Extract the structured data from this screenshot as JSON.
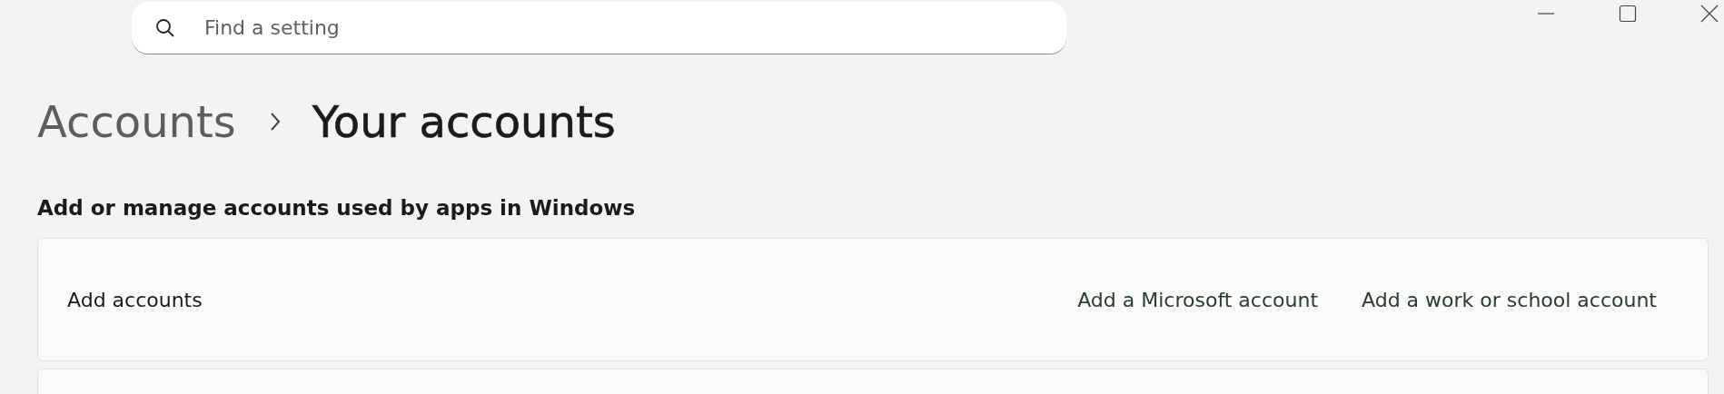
{
  "search": {
    "placeholder": "Find a setting"
  },
  "window_controls": [
    {
      "kind": "minimize"
    },
    {
      "kind": "maximize"
    },
    {
      "kind": "close"
    }
  ],
  "breadcrumb": [
    {
      "label": "Accounts",
      "current": false
    },
    {
      "label": "Your accounts",
      "current": true
    }
  ],
  "section_title": "Add or manage accounts used by apps in Windows",
  "cards": [
    {
      "label": "Add accounts",
      "links": [
        "Add a Microsoft account",
        "Add a work or school account"
      ]
    },
    {
      "kind": "empty"
    }
  ]
}
